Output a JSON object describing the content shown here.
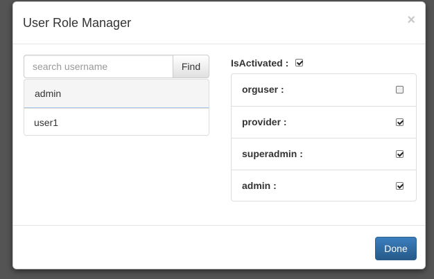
{
  "modal": {
    "title": "User Role Manager",
    "close_glyph": "×"
  },
  "search": {
    "placeholder": "search username",
    "value": "",
    "find_label": "Find"
  },
  "users": [
    {
      "name": "admin",
      "selected": true
    },
    {
      "name": "user1",
      "selected": false
    }
  ],
  "activation": {
    "label": "IsActivated :",
    "checked": true
  },
  "roles": [
    {
      "label": "orguser :",
      "checked": false
    },
    {
      "label": "provider :",
      "checked": true
    },
    {
      "label": "superadmin :",
      "checked": true
    },
    {
      "label": "admin :",
      "checked": true
    }
  ],
  "footer": {
    "done_label": "Done"
  },
  "colors": {
    "primary": "#337ab7",
    "backdrop": "#545454",
    "selected_border": "#a8c7e6"
  }
}
